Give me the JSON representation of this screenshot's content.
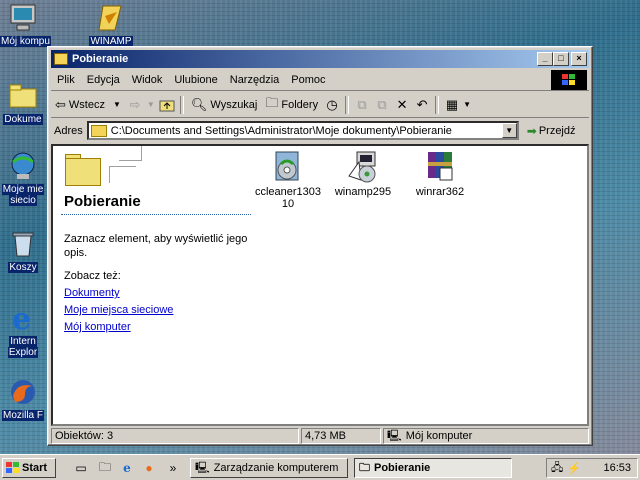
{
  "desktop": {
    "icons": [
      {
        "label": "Mój kompu",
        "icon": "my-computer-icon"
      },
      {
        "label": "WINAMP",
        "icon": "winamp-shortcut-icon"
      },
      {
        "label": "Dokume",
        "icon": "my-documents-icon"
      },
      {
        "label": "Moje mie",
        "label2": "siecio",
        "icon": "network-places-icon"
      },
      {
        "label": "Koszy",
        "icon": "recycle-bin-icon"
      },
      {
        "label": "Intern",
        "label2": "Explor",
        "icon": "internet-explorer-icon"
      },
      {
        "label": "Mozilla F",
        "icon": "firefox-icon"
      }
    ]
  },
  "window": {
    "title": "Pobieranie",
    "controls": {
      "minimize": "_",
      "maximize": "□",
      "close": "×"
    },
    "menu": [
      "Plik",
      "Edycja",
      "Widok",
      "Ulubione",
      "Narzędzia",
      "Pomoc"
    ],
    "toolbar": {
      "back": "Wstecz",
      "search": "Wyszukaj",
      "folders": "Foldery"
    },
    "address": {
      "label": "Adres",
      "value": "C:\\Documents and Settings\\Administrator\\Moje dokumenty\\Pobieranie",
      "go": "Przejdź"
    },
    "left_pane": {
      "title": "Pobieranie",
      "description": "Zaznacz element, aby wyświetlić jego opis.",
      "see_also": "Zobacz też:",
      "links": [
        "Dokumenty",
        "Moje miejsca sieciowe",
        "Mój komputer"
      ]
    },
    "files": [
      {
        "name": "ccleaner130310",
        "icon": "ccleaner-installer-icon"
      },
      {
        "name": "winamp295",
        "icon": "winamp-installer-icon"
      },
      {
        "name": "winrar362",
        "icon": "winrar-installer-icon"
      }
    ],
    "status": {
      "objects": "Obiektów: 3",
      "size": "4,73 MB",
      "location": "Mój komputer"
    }
  },
  "taskbar": {
    "start": "Start",
    "more": "»",
    "tasks": [
      {
        "label": "Zarządzanie komputerem",
        "active": false
      },
      {
        "label": "Pobieranie",
        "active": true
      }
    ],
    "clock": "16:53"
  },
  "colors": {
    "title_start": "#0a246a",
    "title_end": "#a6caf0",
    "face": "#d4d0c8",
    "link": "#0000cc"
  }
}
